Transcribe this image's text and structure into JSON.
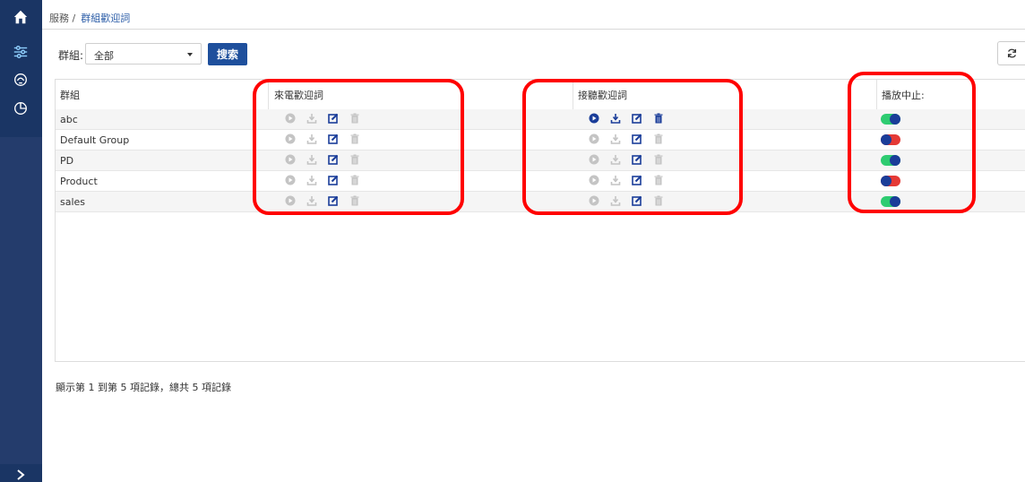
{
  "breadcrumb": {
    "parent": "服務 /",
    "current": "群組歡迎詞"
  },
  "filter": {
    "label": "群組:",
    "selected": "全部",
    "search_label": "搜索"
  },
  "table": {
    "headers": {
      "group": "群組",
      "incoming": "來電歡迎詞",
      "answer": "接聽歡迎詞",
      "stop": "播放中止:"
    },
    "rows": [
      {
        "name": "abc",
        "incoming_active": false,
        "answer_active": true,
        "stop_on": true
      },
      {
        "name": "Default Group",
        "incoming_active": false,
        "answer_active": false,
        "stop_on": false
      },
      {
        "name": "PD",
        "incoming_active": false,
        "answer_active": false,
        "stop_on": true
      },
      {
        "name": "Product",
        "incoming_active": false,
        "answer_active": false,
        "stop_on": false
      },
      {
        "name": "sales",
        "incoming_active": false,
        "answer_active": false,
        "stop_on": true
      }
    ]
  },
  "footer": {
    "info": "顯示第 1 到第 5 項記錄，總共 5 項記錄"
  },
  "colors": {
    "primary": "#1e4f9c",
    "sidebar": "#243c6c",
    "toggle_on": "#2ecc71",
    "toggle_off": "#e53935",
    "annotation": "#ff0000"
  },
  "icons": [
    "home-icon",
    "sliders-icon",
    "headset-icon",
    "pie-chart-icon",
    "chevron-right-icon",
    "refresh-icon",
    "play-icon",
    "download-icon",
    "edit-icon",
    "trash-icon"
  ]
}
